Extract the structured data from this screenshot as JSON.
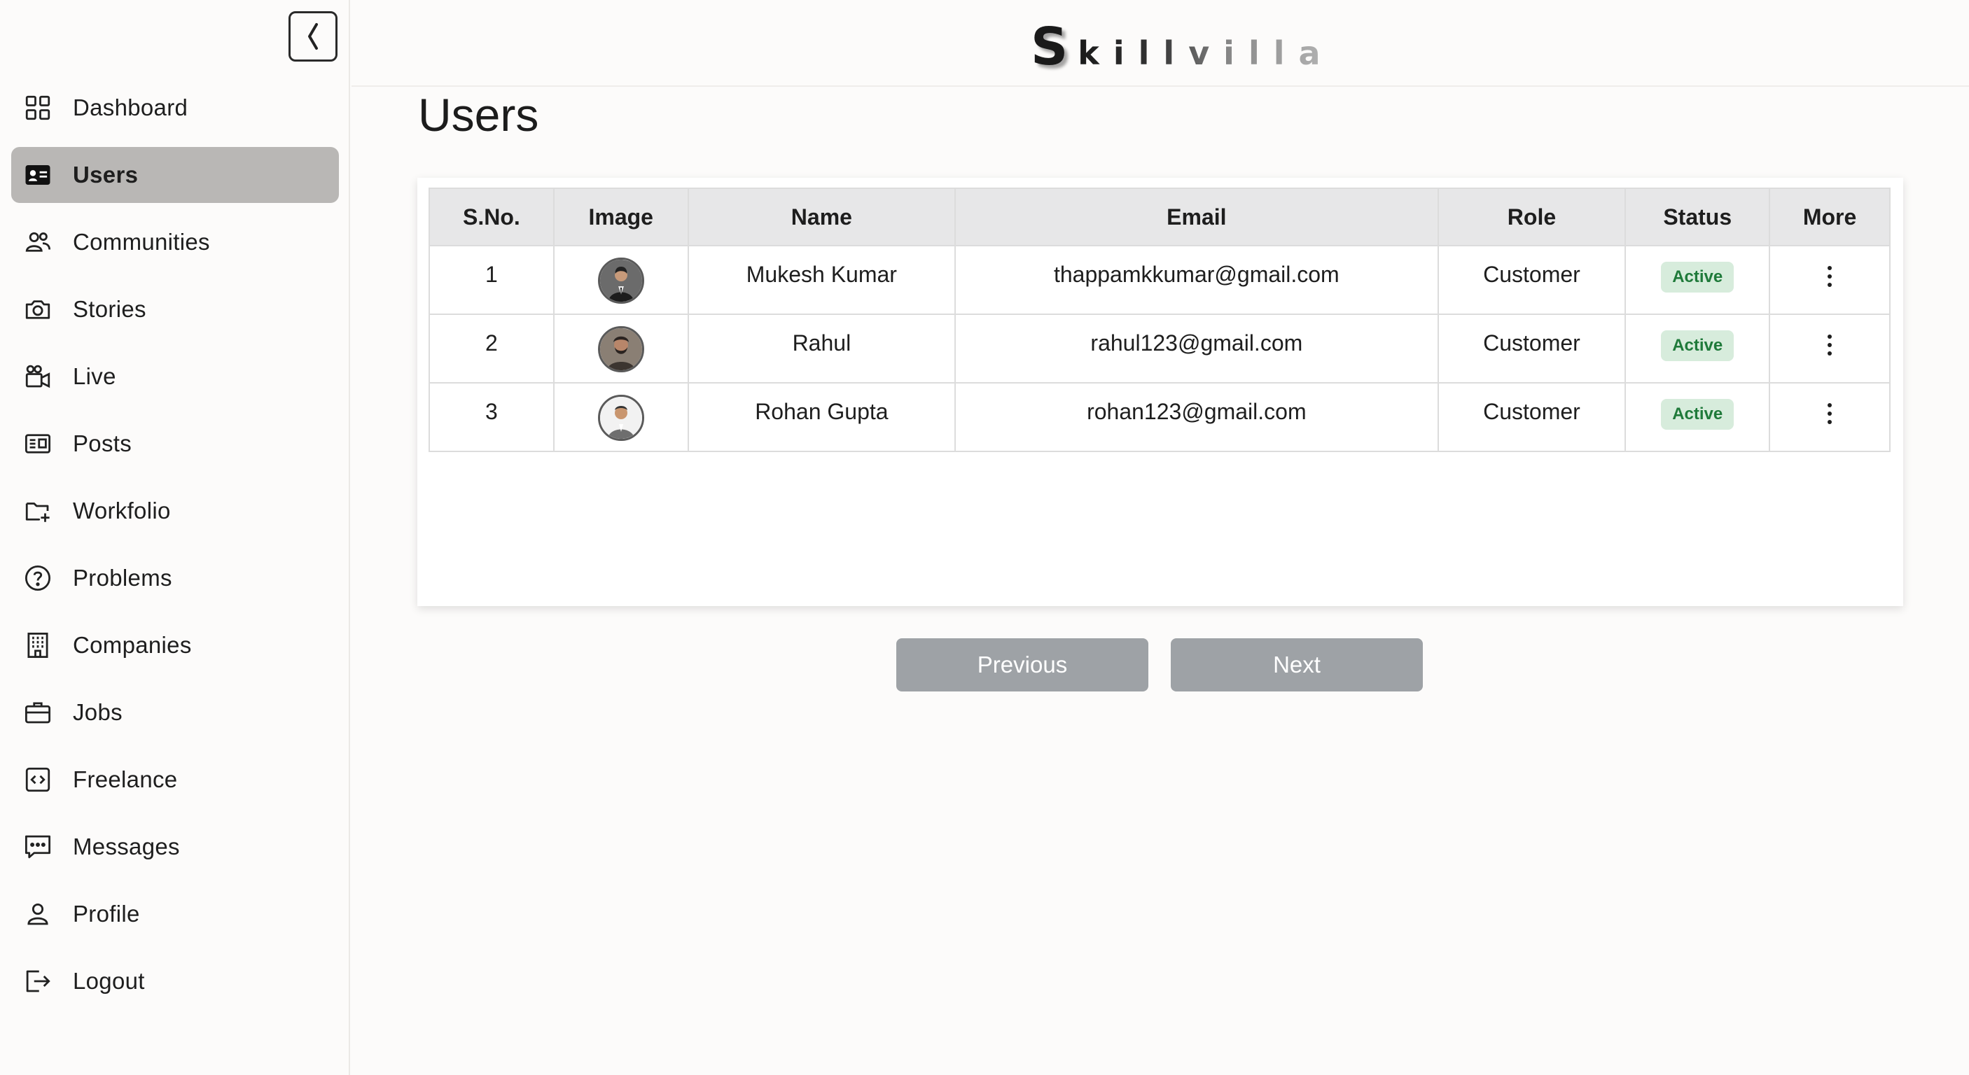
{
  "brand": {
    "first": "S",
    "rest": "killvilla"
  },
  "sidebar": {
    "items": [
      {
        "label": "Dashboard",
        "icon": "grid-icon"
      },
      {
        "label": "Users",
        "icon": "id-card-icon",
        "active": true
      },
      {
        "label": "Communities",
        "icon": "people-icon"
      },
      {
        "label": "Stories",
        "icon": "camera-icon"
      },
      {
        "label": "Live",
        "icon": "video-camera-icon"
      },
      {
        "label": "Posts",
        "icon": "newspaper-icon"
      },
      {
        "label": "Workfolio",
        "icon": "folder-plus-icon"
      },
      {
        "label": "Problems",
        "icon": "question-circle-icon"
      },
      {
        "label": "Companies",
        "icon": "building-icon"
      },
      {
        "label": "Jobs",
        "icon": "briefcase-icon"
      },
      {
        "label": "Freelance",
        "icon": "code-square-icon"
      },
      {
        "label": "Messages",
        "icon": "chat-dots-icon"
      },
      {
        "label": "Profile",
        "icon": "person-icon"
      },
      {
        "label": "Logout",
        "icon": "logout-icon"
      }
    ]
  },
  "main": {
    "title": "Users",
    "table": {
      "headers": [
        "S.No.",
        "Image",
        "Name",
        "Email",
        "Role",
        "Status",
        "More"
      ],
      "rows": [
        {
          "sno": "1",
          "name": "Mukesh Kumar",
          "email": "thappamkkumar@gmail.com",
          "role": "Customer",
          "status": "Active"
        },
        {
          "sno": "2",
          "name": "Rahul",
          "email": "rahul123@gmail.com",
          "role": "Customer",
          "status": "Active"
        },
        {
          "sno": "3",
          "name": "Rohan Gupta",
          "email": "rohan123@gmail.com",
          "role": "Customer",
          "status": "Active"
        }
      ]
    },
    "pagination": {
      "previous": "Previous",
      "next": "Next"
    }
  },
  "colors": {
    "active_nav_bg": "#b9b7b5",
    "badge_bg": "#d7ecdc",
    "badge_text": "#1f7a3a",
    "pager_bg": "#9ea2a6",
    "page_bg": "#fcfbfa"
  }
}
